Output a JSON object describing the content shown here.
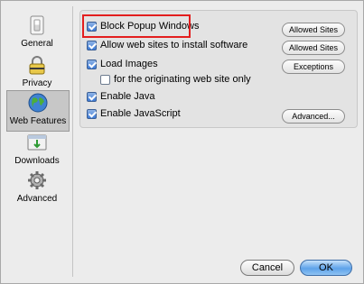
{
  "sidebar": {
    "items": [
      {
        "label": "General",
        "icon": "light-switch-icon"
      },
      {
        "label": "Privacy",
        "icon": "lock-icon"
      },
      {
        "label": "Web Features",
        "icon": "globe-icon",
        "active": true
      },
      {
        "label": "Downloads",
        "icon": "download-window-icon"
      },
      {
        "label": "Advanced",
        "icon": "gear-icon"
      }
    ]
  },
  "options": [
    {
      "label": "Block Popup Windows",
      "checked": true
    },
    {
      "label": "Allow web sites to install software",
      "checked": true
    },
    {
      "label": "Load Images",
      "checked": true
    },
    {
      "label": "for the originating web site only",
      "checked": false
    },
    {
      "label": "Enable Java",
      "checked": true
    },
    {
      "label": "Enable JavaScript",
      "checked": true
    }
  ],
  "buttons": {
    "allowed_sites_popup": "Allowed Sites",
    "allowed_sites_install": "Allowed Sites",
    "exceptions": "Exceptions",
    "advanced": "Advanced...",
    "cancel": "Cancel",
    "ok": "OK"
  },
  "colors": {
    "highlight": "#e31e1e",
    "accent": "#5ea3ea"
  }
}
